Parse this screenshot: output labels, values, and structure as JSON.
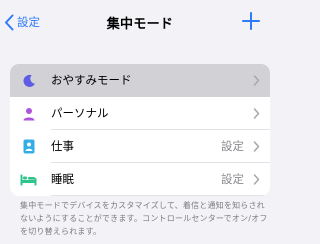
{
  "nav": {
    "back_label": "設定",
    "title": "集中モード"
  },
  "modes": [
    {
      "label": "おやすみモード",
      "detail": "",
      "icon": "moon-icon",
      "icon_color": "#5e5ce6"
    },
    {
      "label": "パーソナル",
      "detail": "",
      "icon": "person-icon",
      "icon_color": "#af52de"
    },
    {
      "label": "仕事",
      "detail": "設定",
      "icon": "id-badge-icon",
      "icon_color": "#32ade6"
    },
    {
      "label": "睡眠",
      "detail": "設定",
      "icon": "bed-icon",
      "icon_color": "#30c48d"
    }
  ],
  "footer": {
    "text": "集中モードでデバイスをカスタマイズして、着信と通知を知らされないようにすることができます。コントロールセンターでオン/オフを切り替えられます。"
  },
  "colors": {
    "accent": "#2f7cf6",
    "background": "#f2f2f7",
    "highlight": "#d1d1d6"
  }
}
